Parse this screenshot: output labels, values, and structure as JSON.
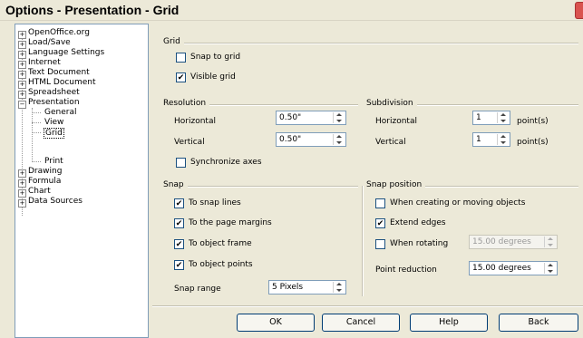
{
  "window": {
    "title": "Options - Presentation - Grid"
  },
  "tree": {
    "items": [
      {
        "label": "OpenOffice.org",
        "expanded": false
      },
      {
        "label": "Load/Save",
        "expanded": false
      },
      {
        "label": "Language Settings",
        "expanded": false
      },
      {
        "label": "Internet",
        "expanded": false
      },
      {
        "label": "Text Document",
        "expanded": false
      },
      {
        "label": "HTML Document",
        "expanded": false
      },
      {
        "label": "Spreadsheet",
        "expanded": false
      },
      {
        "label": "Presentation",
        "expanded": true
      },
      {
        "label": "Drawing",
        "expanded": false
      },
      {
        "label": "Formula",
        "expanded": false
      },
      {
        "label": "Chart",
        "expanded": false
      },
      {
        "label": "Data Sources",
        "expanded": false
      }
    ],
    "presentation_children": [
      "General",
      "View",
      "Grid",
      "Print"
    ],
    "selected": "Grid"
  },
  "grid": {
    "heading": "Grid",
    "snap_to_grid": {
      "label": "Snap to grid",
      "checked": false
    },
    "visible_grid": {
      "label": "Visible grid",
      "checked": true
    }
  },
  "resolution": {
    "heading": "Resolution",
    "horizontal": {
      "label": "Horizontal",
      "value": "0.50\""
    },
    "vertical": {
      "label": "Vertical",
      "value": "0.50\""
    },
    "synchronize": {
      "label": "Synchronize axes",
      "checked": false
    }
  },
  "subdivision": {
    "heading": "Subdivision",
    "horizontal": {
      "label": "Horizontal",
      "value": "1",
      "unit": "point(s)"
    },
    "vertical": {
      "label": "Vertical",
      "value": "1",
      "unit": "point(s)"
    }
  },
  "snap": {
    "heading": "Snap",
    "snap_lines": {
      "label": "To snap lines",
      "checked": true
    },
    "page_margins": {
      "label": "To the page margins",
      "checked": true
    },
    "object_frame": {
      "label": "To object frame",
      "checked": true
    },
    "object_points": {
      "label": "To object points",
      "checked": true
    },
    "snap_range": {
      "label": "Snap range",
      "value": "5 Pixels"
    }
  },
  "snap_position": {
    "heading": "Snap position",
    "creating_moving": {
      "label": "When creating or moving objects",
      "checked": false
    },
    "extend_edges": {
      "label": "Extend edges",
      "checked": true
    },
    "rotating": {
      "label": "When rotating",
      "checked": false,
      "value": "15.00 degrees"
    },
    "point_reduction": {
      "label": "Point reduction",
      "value": "15.00 degrees"
    }
  },
  "buttons": {
    "ok": "OK",
    "cancel": "Cancel",
    "help": "Help",
    "back": "Back"
  }
}
